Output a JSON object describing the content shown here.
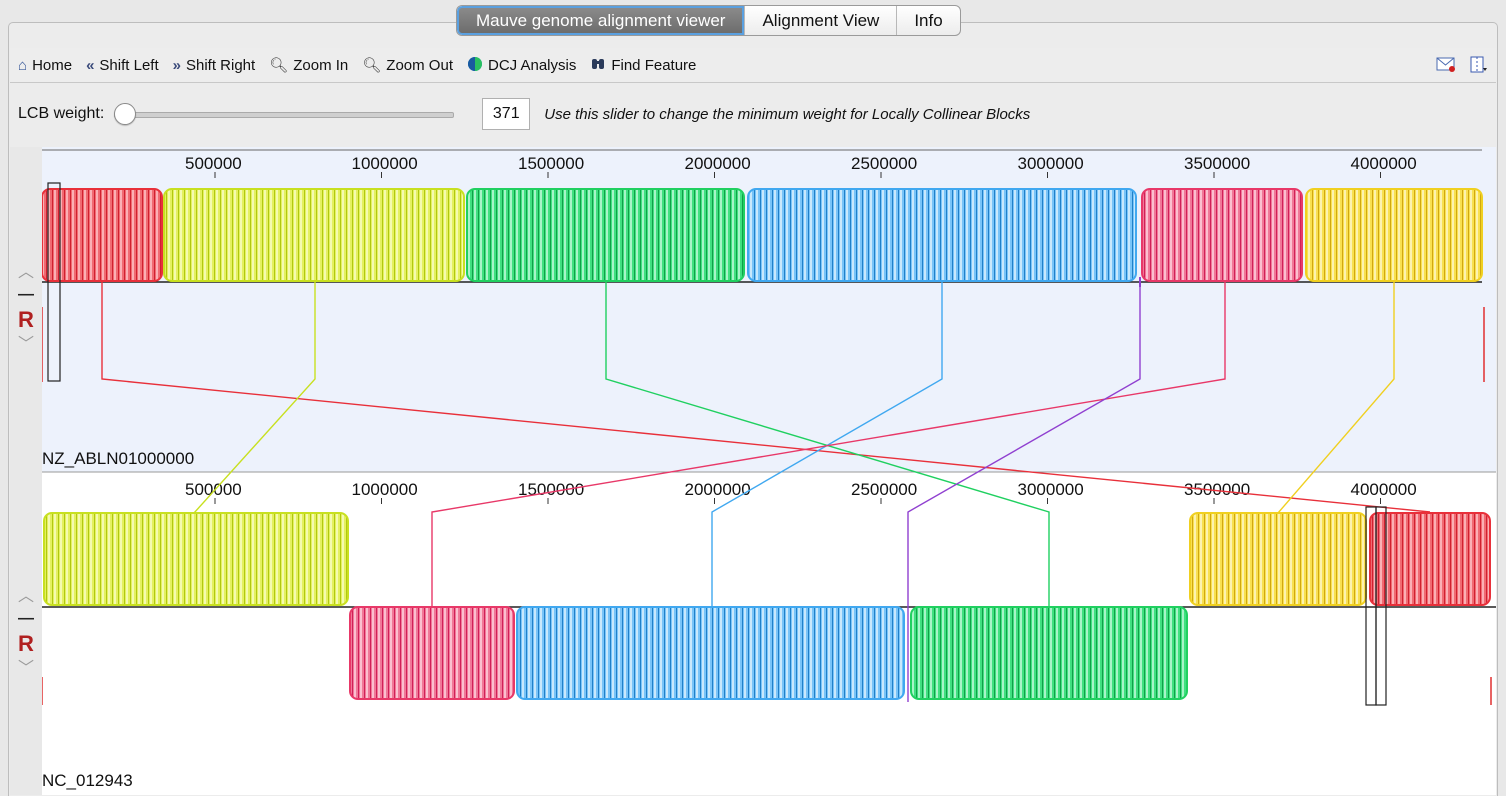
{
  "tabs": [
    {
      "label": "Mauve genome alignment viewer",
      "active": true
    },
    {
      "label": "Alignment View",
      "active": false
    },
    {
      "label": "Info",
      "active": false
    }
  ],
  "toolbar": {
    "home": "Home",
    "shift_left": "Shift Left",
    "shift_right": "Shift Right",
    "zoom_in": "Zoom In",
    "zoom_out": "Zoom Out",
    "dcj": "DCJ Analysis",
    "find_feature": "Find Feature"
  },
  "lcb": {
    "label": "LCB weight:",
    "value": "371",
    "slider_fraction": 0.0,
    "hint": "Use this slider to change the minimum weight for Locally Collinear Blocks"
  },
  "genomes": [
    {
      "name": "NZ_ABLN01000000",
      "ticks": [
        "500000",
        "1000000",
        "1500000",
        "2000000",
        "2500000",
        "3000000",
        "3500000",
        "4000000"
      ]
    },
    {
      "name": "NC_012943",
      "ticks": [
        "500000",
        "1000000",
        "1500000",
        "2000000",
        "2500000",
        "3000000",
        "3500000",
        "4000000"
      ]
    }
  ],
  "controls": {
    "reverse_label": "R"
  },
  "colors": {
    "red": "#e8303a",
    "yellowgreen": "#c8e020",
    "green": "#20d060",
    "blue": "#40a8f0",
    "pink": "#e83868",
    "yellow": "#f0d020",
    "purple": "#9040d0",
    "highlight_bg": "#edf2fc"
  }
}
